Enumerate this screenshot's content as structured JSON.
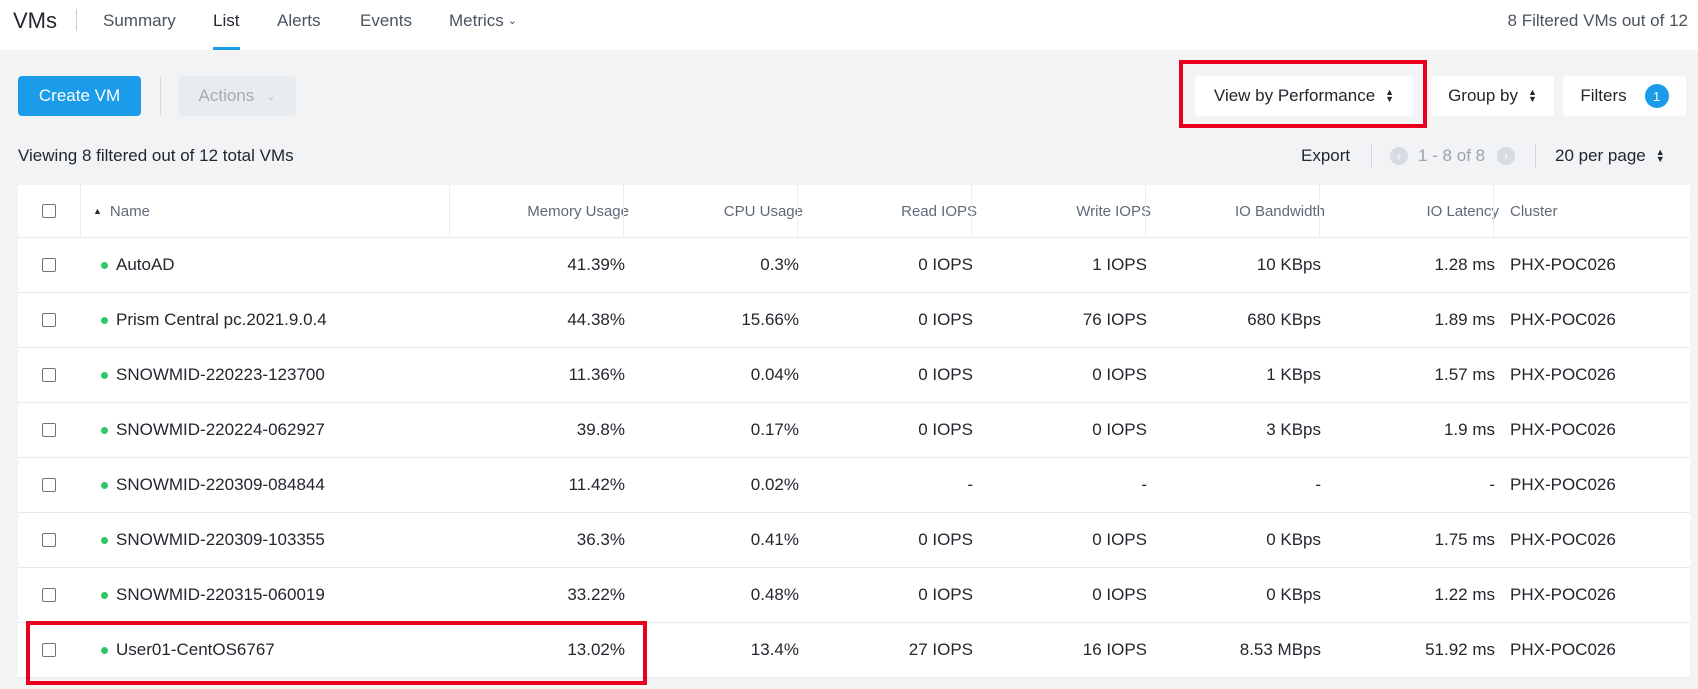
{
  "header": {
    "app_title": "VMs",
    "tabs": [
      {
        "label": "Summary"
      },
      {
        "label": "List"
      },
      {
        "label": "Alerts"
      },
      {
        "label": "Events"
      },
      {
        "label": "Metrics"
      }
    ],
    "active_tab": "List",
    "filtered_count": "8 Filtered VMs out of 12"
  },
  "toolbar": {
    "create_label": "Create VM",
    "actions_label": "Actions",
    "view_by_label": "View by Performance",
    "group_by_label": "Group by",
    "filters_label": "Filters",
    "filters_count": "1"
  },
  "subbar": {
    "viewing_text": "Viewing 8 filtered out of 12 total VMs",
    "export_label": "Export",
    "page_range": "1 - 8 of 8",
    "per_page": "20 per page"
  },
  "accent_color": "#1b9cea",
  "status_color": "#2ec667",
  "highlight_color": "#e8001c",
  "table": {
    "columns": [
      "Name",
      "Memory Usage",
      "CPU Usage",
      "Read IOPS",
      "Write IOPS",
      "IO Bandwidth",
      "IO Latency",
      "Cluster"
    ],
    "rows": [
      [
        "AutoAD",
        "41.39%",
        "0.3%",
        "0 IOPS",
        "1 IOPS",
        "10 KBps",
        "1.28 ms",
        "PHX-POC026"
      ],
      [
        "Prism Central pc.2021.9.0.4",
        "44.38%",
        "15.66%",
        "0 IOPS",
        "76 IOPS",
        "680 KBps",
        "1.89 ms",
        "PHX-POC026"
      ],
      [
        "SNOWMID-220223-123700",
        "11.36%",
        "0.04%",
        "0 IOPS",
        "0 IOPS",
        "1 KBps",
        "1.57 ms",
        "PHX-POC026"
      ],
      [
        "SNOWMID-220224-062927",
        "39.8%",
        "0.17%",
        "0 IOPS",
        "0 IOPS",
        "3 KBps",
        "1.9 ms",
        "PHX-POC026"
      ],
      [
        "SNOWMID-220309-084844",
        "11.42%",
        "0.02%",
        "-",
        "-",
        "-",
        "-",
        "PHX-POC026"
      ],
      [
        "SNOWMID-220309-103355",
        "36.3%",
        "0.41%",
        "0 IOPS",
        "0 IOPS",
        "0 KBps",
        "1.75 ms",
        "PHX-POC026"
      ],
      [
        "SNOWMID-220315-060019",
        "33.22%",
        "0.48%",
        "0 IOPS",
        "0 IOPS",
        "0 KBps",
        "1.22 ms",
        "PHX-POC026"
      ],
      [
        "User01-CentOS6767",
        "13.02%",
        "13.4%",
        "27 IOPS",
        "16 IOPS",
        "8.53 MBps",
        "51.92 ms",
        "PHX-POC026"
      ]
    ]
  }
}
